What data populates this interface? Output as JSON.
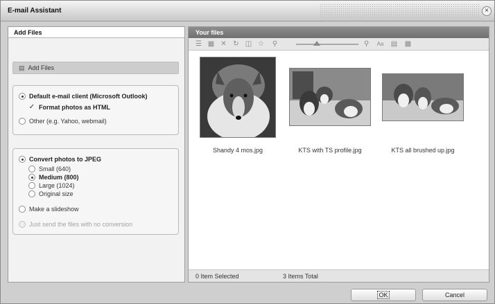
{
  "window": {
    "title": "E-mail Assistant",
    "close_glyph": "×"
  },
  "left_panel": {
    "header": "Add Files",
    "add_files_button": "Add Files",
    "email_client": {
      "default_label": "Default e-mail client (Microsoft Outlook)",
      "format_html_label": "Format photos as HTML",
      "other_label": "Other (e.g. Yahoo, webmail)",
      "selected": "default"
    },
    "conversion": {
      "convert_label": "Convert photos to JPEG",
      "sizes": [
        "Small (640)",
        "Medium (800)",
        "Large (1024)",
        "Original size"
      ],
      "selected_size": "Medium (800)",
      "slideshow_label": "Make a slideshow",
      "no_conversion_label": "Just send the files with no conversion",
      "selected": "convert"
    }
  },
  "right_panel": {
    "header": "Your files",
    "toolbar_icons": [
      "list-icon",
      "thumbnail-icon",
      "delete-icon",
      "rotate-icon",
      "export-icon",
      "favorite-icon",
      "zoom-out-icon",
      "zoom-in-icon",
      "rename-icon",
      "details-icon",
      "properties-icon"
    ],
    "zoom_level": 0.25,
    "files": [
      {
        "name": "Shandy 4 mos.jpg"
      },
      {
        "name": "KTS with TS profile.jpg"
      },
      {
        "name": "KTS all brushed up.jpg"
      }
    ],
    "status": {
      "selected": "0 Item Selected",
      "total": "3 Items Total"
    }
  },
  "buttons": {
    "ok": "OK",
    "cancel": "Cancel"
  }
}
